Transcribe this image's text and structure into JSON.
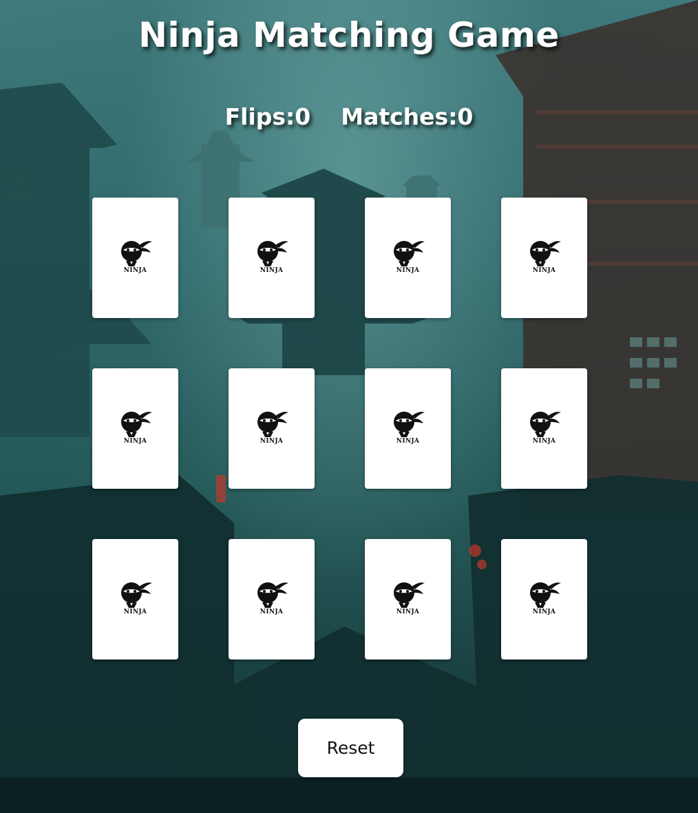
{
  "game": {
    "title": "Ninja Matching Game",
    "flips_label": "Flips: ",
    "flips_value": "0",
    "matches_label": "Matches: ",
    "matches_value": "0",
    "reset_label": "Reset"
  },
  "cards": [
    {
      "face": "down",
      "logo_text": "NINJA"
    },
    {
      "face": "down",
      "logo_text": "NINJA"
    },
    {
      "face": "down",
      "logo_text": "NINJA"
    },
    {
      "face": "down",
      "logo_text": "NINJA"
    },
    {
      "face": "down",
      "logo_text": "NINJA"
    },
    {
      "face": "down",
      "logo_text": "NINJA"
    },
    {
      "face": "down",
      "logo_text": "NINJA"
    },
    {
      "face": "down",
      "logo_text": "NINJA"
    },
    {
      "face": "down",
      "logo_text": "NINJA"
    },
    {
      "face": "down",
      "logo_text": "NINJA"
    },
    {
      "face": "down",
      "logo_text": "NINJA"
    },
    {
      "face": "down",
      "logo_text": "NINJA"
    }
  ],
  "colors": {
    "background": "#2f6a6c",
    "card": "#ffffff",
    "text": "#ffffff"
  }
}
